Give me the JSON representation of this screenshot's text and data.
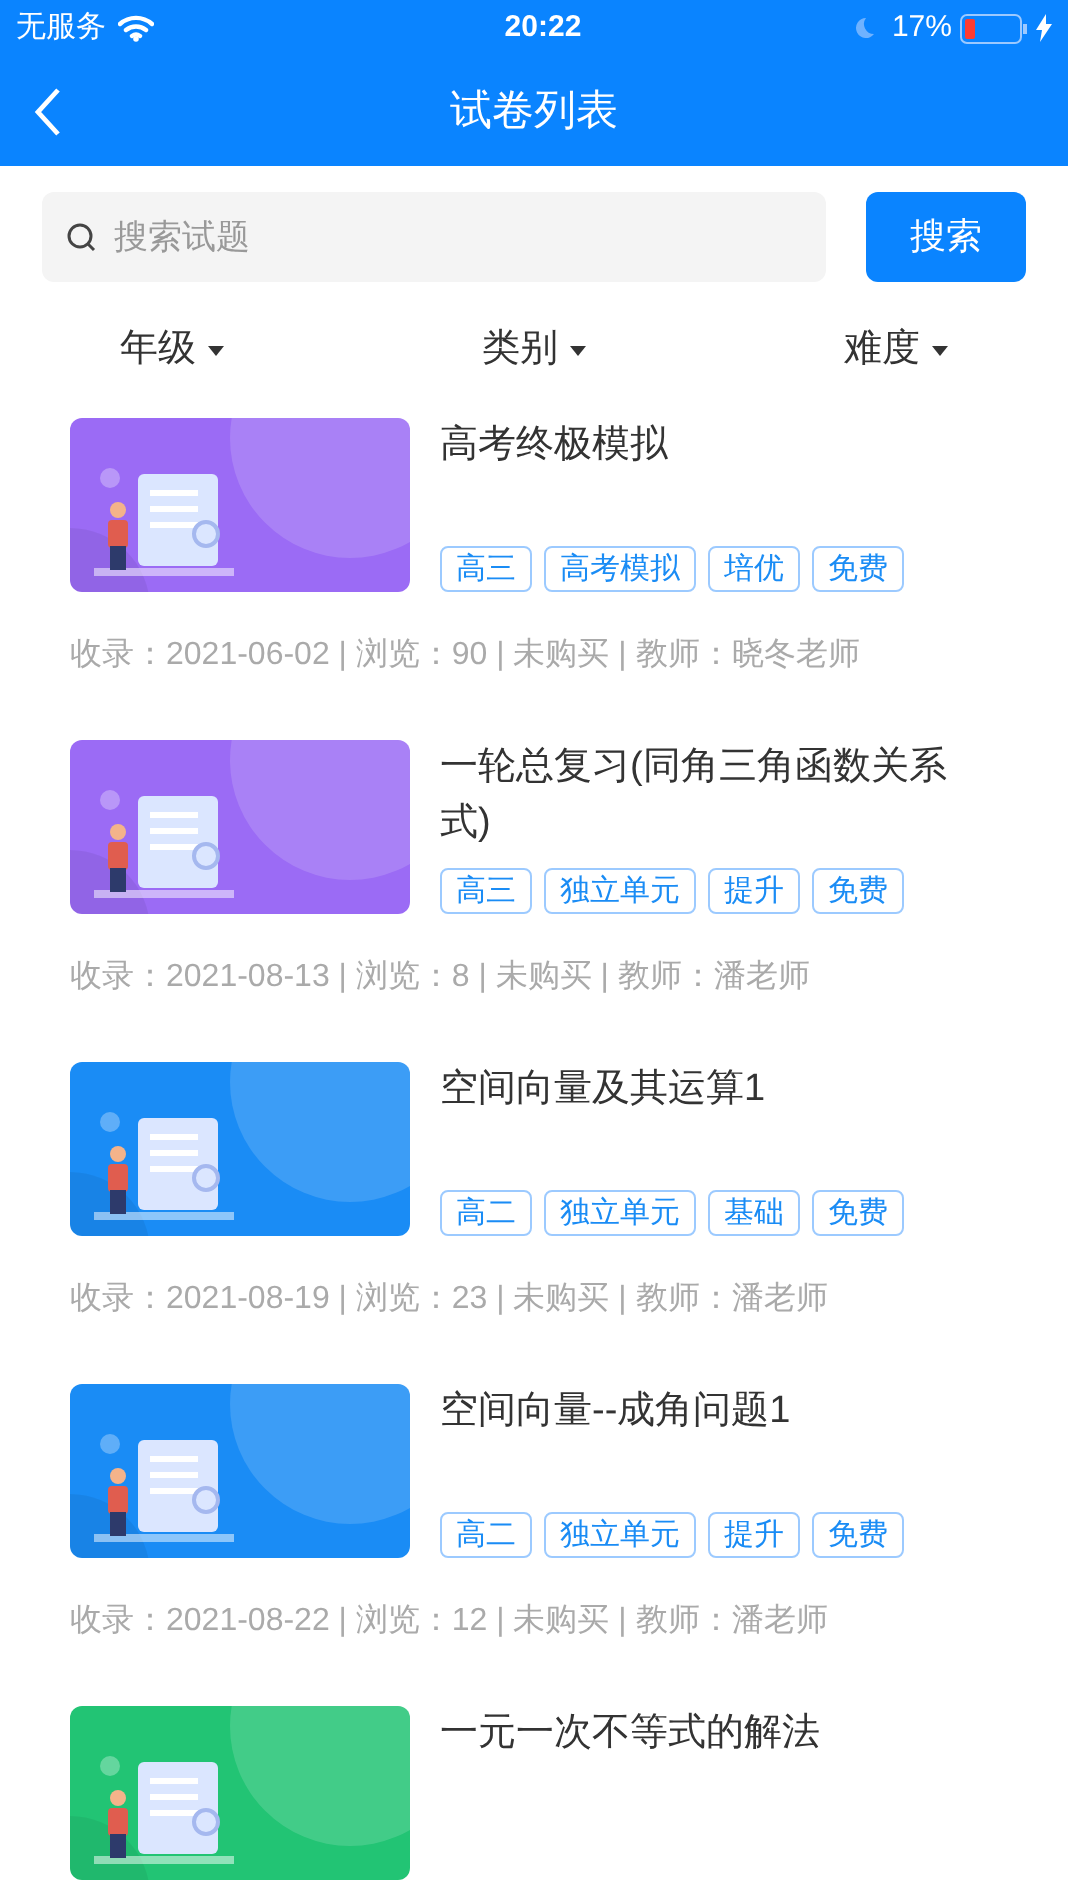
{
  "status_bar": {
    "carrier": "无服务",
    "time": "20:22",
    "battery": "17%"
  },
  "nav": {
    "title": "试卷列表"
  },
  "search": {
    "placeholder": "搜索试题",
    "button": "搜索"
  },
  "filters": [
    {
      "label": "年级"
    },
    {
      "label": "类别"
    },
    {
      "label": "难度"
    }
  ],
  "papers": [
    {
      "title": "高考终极模拟",
      "thumbnail": {
        "kind": "picture",
        "color": "#9b6bf5"
      },
      "tags": [
        "高三",
        "高考模拟",
        "培优",
        "免费"
      ],
      "meta": "收录：2021-06-02 | 浏览：90 | 未购买 | 教师：晓冬老师"
    },
    {
      "title": "一轮总复习(同角三角函数关系式)",
      "thumbnail": {
        "kind": "picture",
        "color": "#9b6bf5"
      },
      "tags": [
        "高三",
        "独立单元",
        "提升",
        "免费"
      ],
      "meta": "收录：2021-08-13 | 浏览：8 | 未购买 | 教师：潘老师"
    },
    {
      "title": "空间向量及其运算1",
      "thumbnail": {
        "kind": "picture",
        "color": "#1a8cf5"
      },
      "tags": [
        "高二",
        "独立单元",
        "基础",
        "免费"
      ],
      "meta": "收录：2021-08-19 | 浏览：23 | 未购买 | 教师：潘老师"
    },
    {
      "title": "空间向量--成角问题1",
      "thumbnail": {
        "kind": "picture",
        "color": "#1a8cf5"
      },
      "tags": [
        "高二",
        "独立单元",
        "提升",
        "免费"
      ],
      "meta": "收录：2021-08-22 | 浏览：12 | 未购买 | 教师：潘老师"
    },
    {
      "title": "一元一次不等式的解法",
      "thumbnail": {
        "kind": "picture",
        "color": "#22c474"
      }
    }
  ]
}
